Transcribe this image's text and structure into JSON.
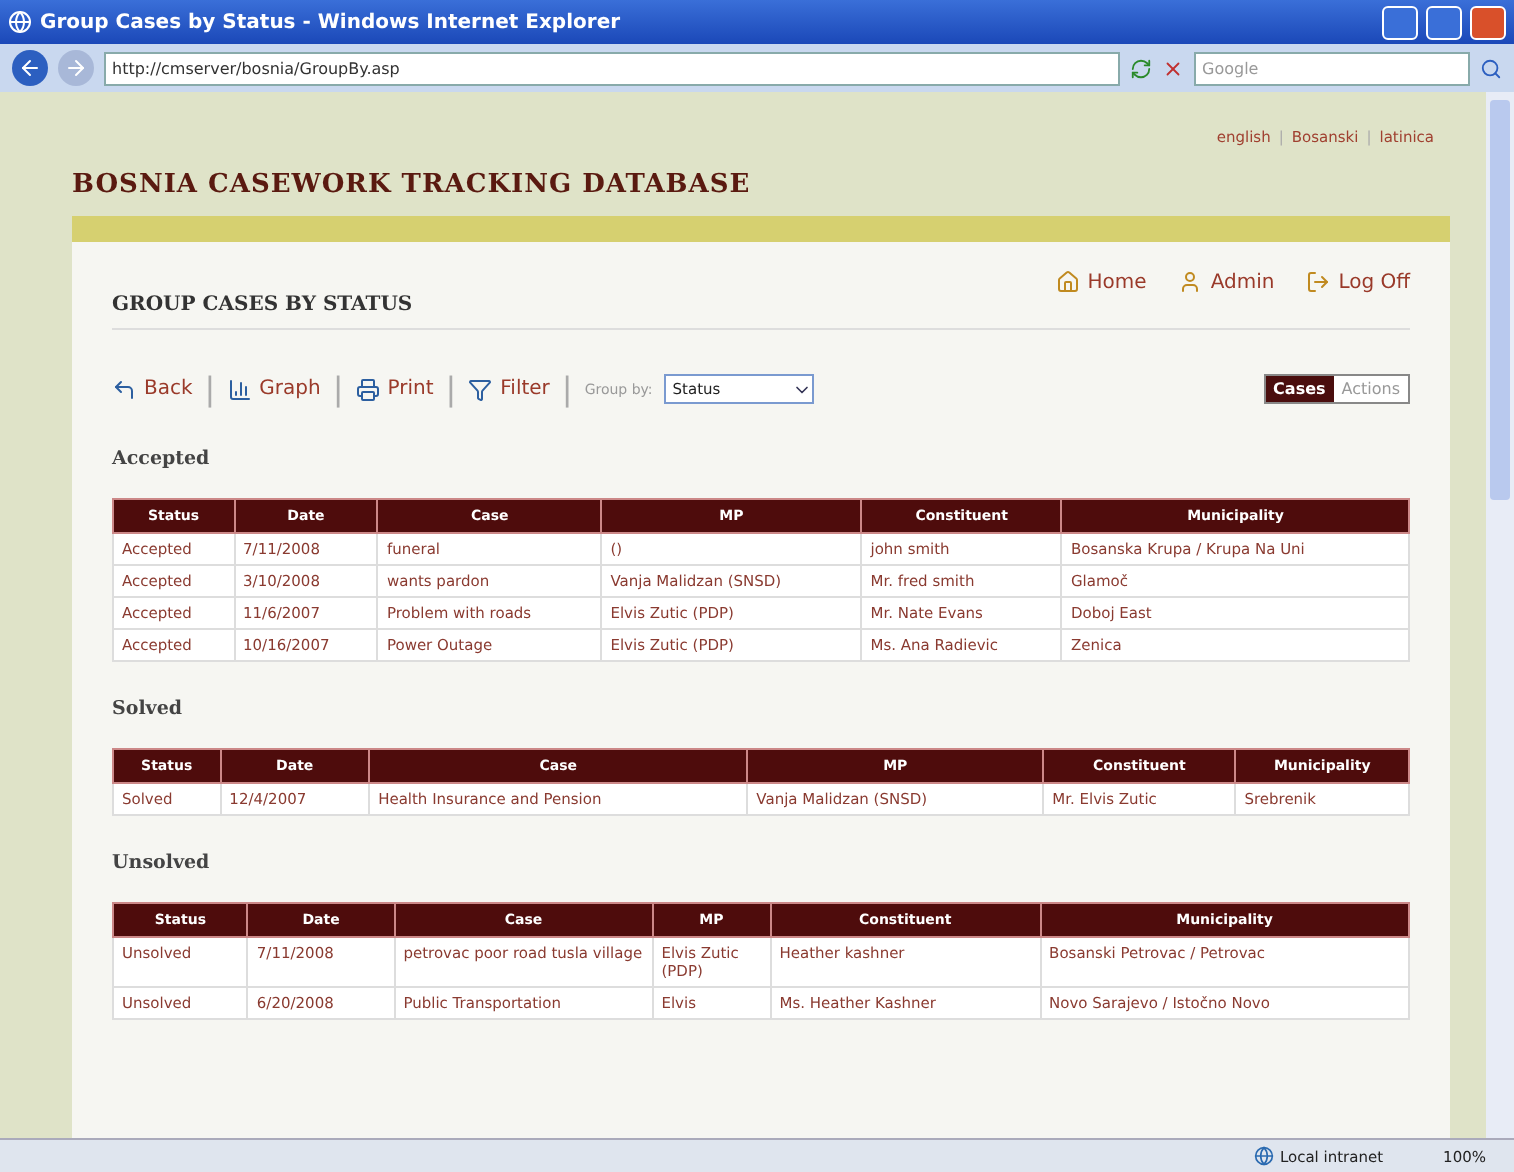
{
  "window": {
    "title": "Group Cases by Status - Windows Internet Explorer"
  },
  "address_bar": {
    "url": "http://cmserver/bosnia/GroupBy.asp",
    "search_placeholder": "Google"
  },
  "languages": [
    "english",
    "Bosanski",
    "latinica"
  ],
  "separator": "|",
  "site_title": "BOSNIA CASEWORK TRACKING DATABASE",
  "nav_links": [
    {
      "kind": "home",
      "label": "Home"
    },
    {
      "kind": "admin",
      "label": "Admin"
    },
    {
      "kind": "logoff",
      "label": "Log Off"
    }
  ],
  "page_title": "GROUP CASES BY STATUS",
  "actions": [
    {
      "kind": "back",
      "label": "Back"
    },
    {
      "kind": "graph",
      "label": "Graph"
    },
    {
      "kind": "print",
      "label": "Print"
    },
    {
      "kind": "filter",
      "label": "Filter"
    }
  ],
  "group_by": {
    "label": "Group by:",
    "value": "Status"
  },
  "view_toggle": [
    {
      "label": "Cases",
      "selected": true
    },
    {
      "label": "Actions",
      "selected": false
    }
  ],
  "groups": [
    {
      "heading": "Accepted",
      "columns": [
        "Status",
        "Date",
        "Case",
        "MP",
        "Constituent",
        "Municipality"
      ],
      "rows": [
        [
          "Accepted",
          "7/11/2008",
          "funeral",
          "()",
          "john  smith",
          "Bosanska Krupa / Krupa Na Uni"
        ],
        [
          "Accepted",
          "3/10/2008",
          "wants pardon",
          "Vanja Malidzan (SNSD)",
          "Mr. fred smith",
          "Glamoč"
        ],
        [
          "Accepted",
          "11/6/2007",
          "Problem with roads",
          "Elvis Zutic (PDP)",
          "Mr. Nate Evans",
          "Doboj East"
        ],
        [
          "Accepted",
          "10/16/2007",
          "Power Outage",
          "Elvis Zutic (PDP)",
          "Ms. Ana Radievic",
          "Zenica"
        ]
      ]
    },
    {
      "heading": "Solved",
      "columns": [
        "Status",
        "Date",
        "Case",
        "MP",
        "Constituent",
        "Municipality"
      ],
      "rows": [
        [
          "Solved",
          "12/4/2007",
          "Health Insurance and Pension",
          "Vanja Malidzan (SNSD)",
          "Mr. Elvis Zutic",
          "Srebrenik"
        ]
      ]
    },
    {
      "heading": "Unsolved",
      "columns": [
        "Status",
        "Date",
        "Case",
        "MP",
        "Constituent",
        "Municipality"
      ],
      "rows": [
        [
          "Unsolved",
          "7/11/2008",
          "petrovac poor road tusla village",
          "Elvis Zutic (PDP)",
          "Heather  kashner",
          "Bosanski Petrovac / Petrovac"
        ],
        [
          "Unsolved",
          "6/20/2008",
          "Public Transportation",
          "Elvis",
          "Ms. Heather Kashner",
          "Novo Sarajevo / Istočno Novo"
        ]
      ]
    }
  ],
  "status_bar": {
    "zone": "Local intranet",
    "zoom": "100%"
  }
}
